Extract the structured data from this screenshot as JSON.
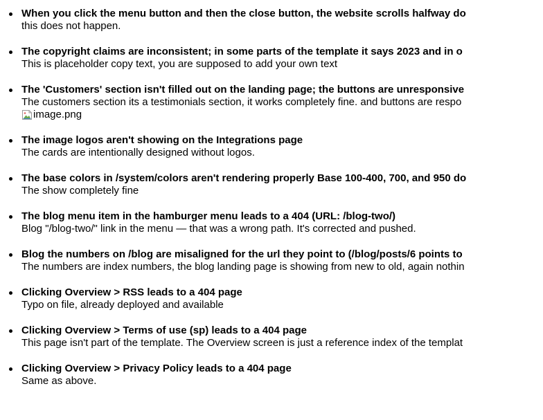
{
  "items": [
    {
      "title": "When you click the menu button and then the close button, the website scrolls halfway do",
      "body": "this does not happen."
    },
    {
      "title": "The copyright claims are inconsistent; in some parts of the template it says 2023 and in o",
      "body": "This is placeholder copy text, you are supposed to add your own text"
    },
    {
      "title": "The 'Customers' section isn't filled out on the landing page; the buttons are unresponsive",
      "body": "The customers section its a testimonials section, it works completely fine. and buttons are respo",
      "image_alt": "image.png"
    },
    {
      "title": "The image logos aren't showing on the Integrations page",
      "body": "The cards are intentionally designed without logos."
    },
    {
      "title": "The base colors in /system/colors aren't rendering properly Base 100-400, 700, and 950 do",
      "body": "The show completely fine"
    },
    {
      "title": "The blog menu item in the hamburger menu leads to a 404 (URL: /blog-two/)",
      "body": "Blog \"/blog-two/\" link in the menu — that was a wrong path. It's corrected and pushed."
    },
    {
      "title": "Blog the numbers on /blog are misaligned for the url they point to (/blog/posts/6 points to",
      "body": "The numbers are index numbers, the blog landing page is showing from new to old, again nothin"
    },
    {
      "title": "Clicking Overview > RSS leads to a 404 page",
      "body": "Typo on file, already deployed and available"
    },
    {
      "title": "Clicking Overview > Terms of use (sp) leads to a 404 page",
      "body": "This page isn't part of the template. The Overview screen is just a reference index of the templat"
    },
    {
      "title": "Clicking Overview > Privacy Policy leads to a 404 page",
      "body": "Same as above."
    }
  ]
}
